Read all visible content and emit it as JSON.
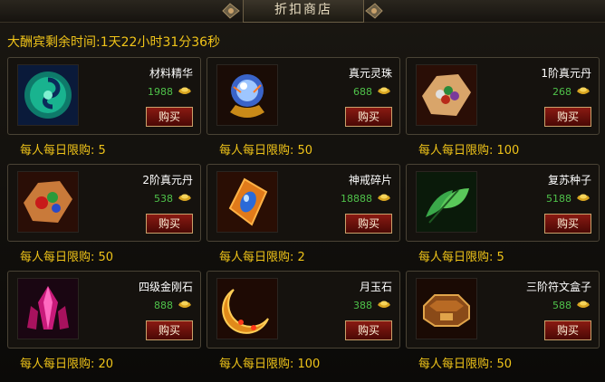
{
  "window": {
    "title": "折扣商店",
    "countdown": "大酬宾剩余时间:1天22小时31分36秒"
  },
  "items": [
    {
      "name": "材料精华",
      "price": "1988",
      "buy_label": "购买",
      "limit": "每人每日限购: 5",
      "icon": "material-essence-orb-icon"
    },
    {
      "name": "真元灵珠",
      "price": "688",
      "buy_label": "购买",
      "limit": "每人每日限购: 50",
      "icon": "spirit-pearl-icon"
    },
    {
      "name": "1阶真元丹",
      "price": "268",
      "buy_label": "购买",
      "limit": "每人每日限购: 100",
      "icon": "pills-on-cloth-icon"
    },
    {
      "name": "2阶真元丹",
      "price": "538",
      "buy_label": "购买",
      "limit": "每人每日限购: 50",
      "icon": "pills-on-cloth-icon"
    },
    {
      "name": "神戒碎片",
      "price": "18888",
      "buy_label": "购买",
      "limit": "每人每日限购: 2",
      "icon": "ring-fragment-icon"
    },
    {
      "name": "复苏种子",
      "price": "5188",
      "buy_label": "购买",
      "limit": "每人每日限购: 5",
      "icon": "leaf-seed-icon"
    },
    {
      "name": "四级金刚石",
      "price": "888",
      "buy_label": "购买",
      "limit": "每人每日限购: 20",
      "icon": "crystal-cluster-icon"
    },
    {
      "name": "月玉石",
      "price": "388",
      "buy_label": "购买",
      "limit": "每人每日限购: 100",
      "icon": "crescent-moon-stone-icon"
    },
    {
      "name": "三阶符文盒子",
      "price": "588",
      "buy_label": "购买",
      "limit": "每人每日限购: 50",
      "icon": "rune-box-icon"
    }
  ],
  "colors": {
    "accent_gold": "#f0c419",
    "price_green": "#4fc24a",
    "buy_red": "#8a1a12"
  }
}
